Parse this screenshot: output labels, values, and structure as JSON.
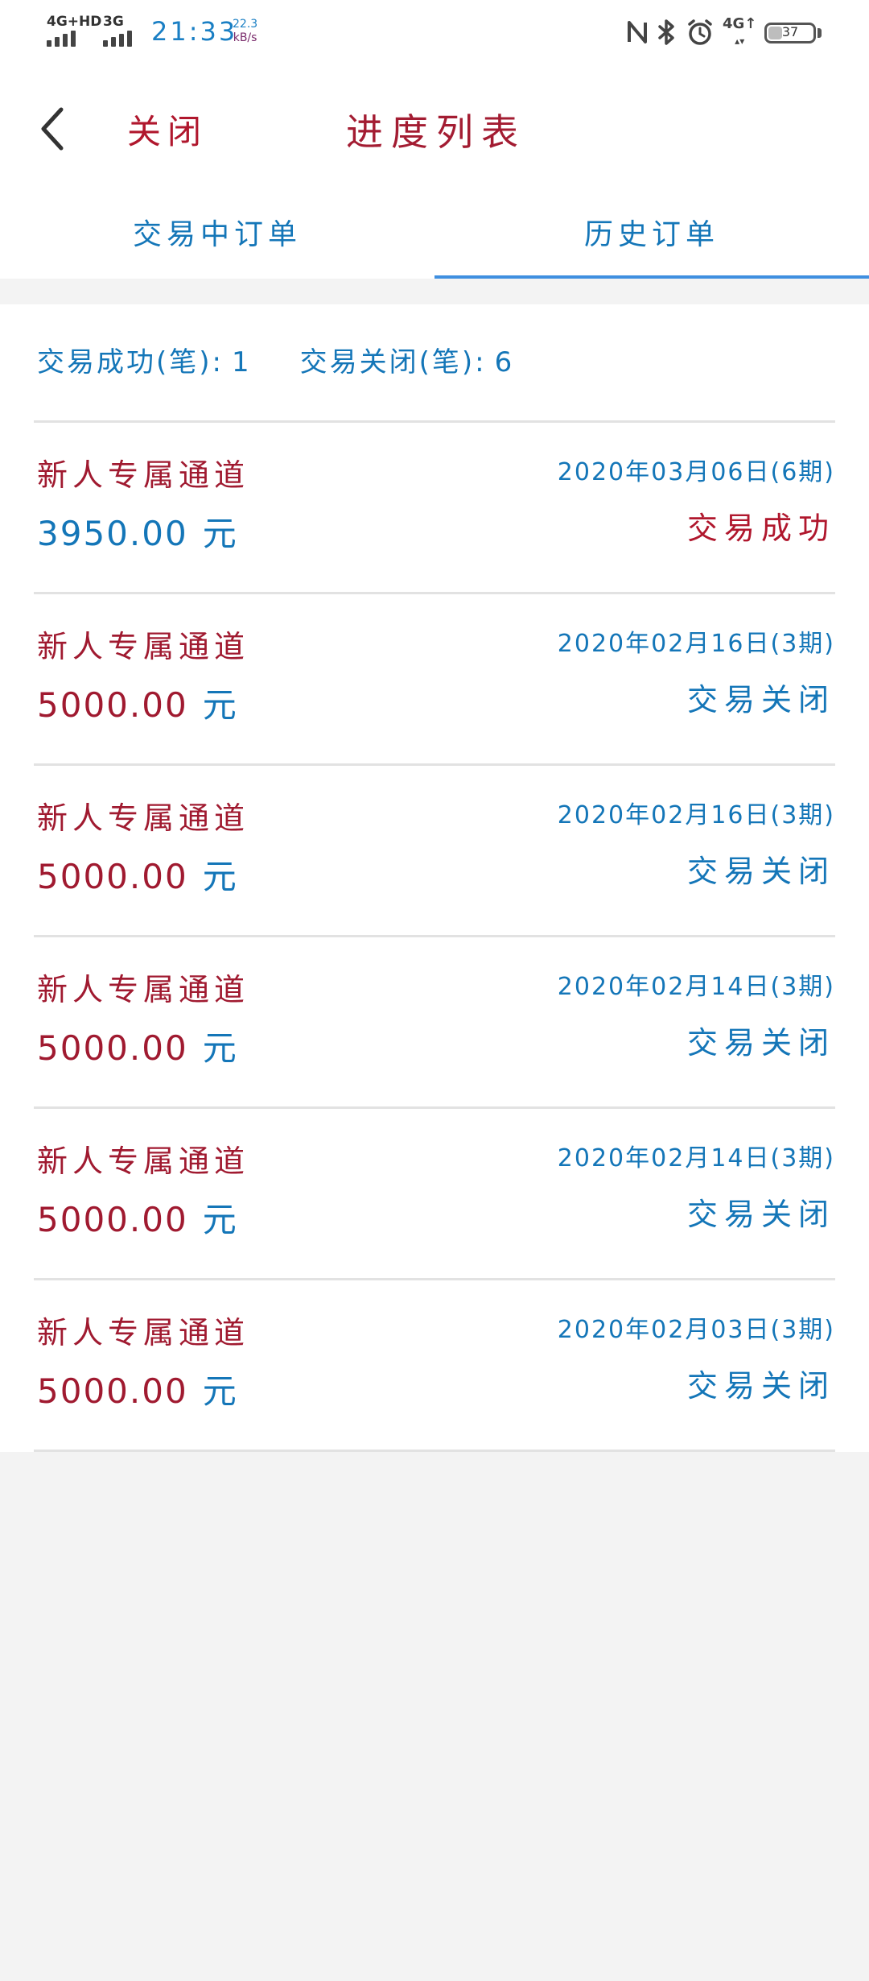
{
  "status_bar": {
    "signal1_label": "4G+HD",
    "signal2_label": "3G",
    "time": "21:33",
    "net_speed_value": "22.3",
    "net_speed_unit": "kB/s",
    "network_label": "4G",
    "battery_level": "37"
  },
  "header": {
    "close_label": "关闭",
    "title": "进度列表"
  },
  "tabs": [
    {
      "label": "交易中订单",
      "active": false
    },
    {
      "label": "历史订单",
      "active": true
    }
  ],
  "summary": {
    "success_label": "交易成功(笔):",
    "success_count": "1",
    "closed_label": "交易关闭(笔):",
    "closed_count": "6"
  },
  "orders": [
    {
      "name": "新人专属通道",
      "amount": "3950.00",
      "currency": "元",
      "date": "2020年03月06日(6期)",
      "status": "交易成功"
    },
    {
      "name": "新人专属通道",
      "amount": "5000.00",
      "currency": "元",
      "date": "2020年02月16日(3期)",
      "status": "交易关闭"
    },
    {
      "name": "新人专属通道",
      "amount": "5000.00",
      "currency": "元",
      "date": "2020年02月16日(3期)",
      "status": "交易关闭"
    },
    {
      "name": "新人专属通道",
      "amount": "5000.00",
      "currency": "元",
      "date": "2020年02月14日(3期)",
      "status": "交易关闭"
    },
    {
      "name": "新人专属通道",
      "amount": "5000.00",
      "currency": "元",
      "date": "2020年02月14日(3期)",
      "status": "交易关闭"
    },
    {
      "name": "新人专属通道",
      "amount": "5000.00",
      "currency": "元",
      "date": "2020年02月03日(3期)",
      "status": "交易关闭"
    }
  ],
  "colors": {
    "accent_blue": "#1476b8",
    "accent_red": "#a01a30",
    "tab_underline": "#3f8fe0",
    "page_background": "#f3f3f3"
  },
  "icons": [
    "signal-icon",
    "nfc-icon",
    "bluetooth-icon",
    "alarm-icon",
    "battery-icon",
    "back-arrow-icon"
  ]
}
